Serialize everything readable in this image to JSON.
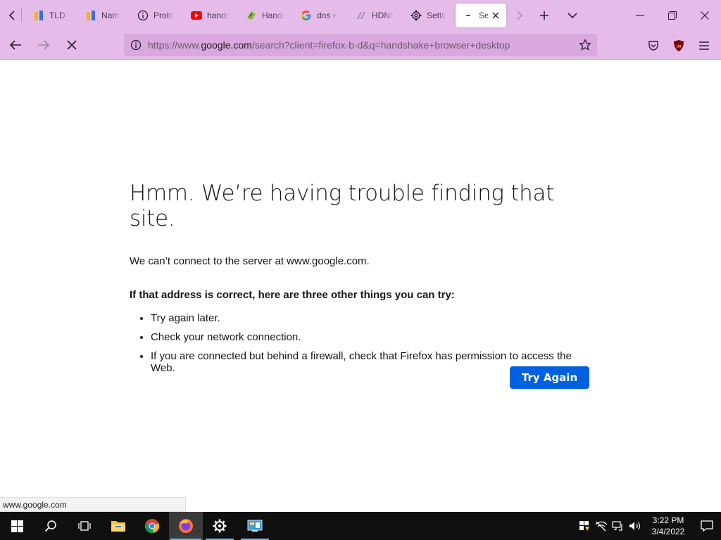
{
  "tabs": [
    {
      "title": "TLD R",
      "icon": "hns-icon"
    },
    {
      "title": "Name",
      "icon": "hns-icon"
    },
    {
      "title": "Proble",
      "icon": "info-icon"
    },
    {
      "title": "hands",
      "icon": "youtube-icon"
    },
    {
      "title": "Hands",
      "icon": "handshake-icon"
    },
    {
      "title": "dns e",
      "icon": "google-icon"
    },
    {
      "title": "HDNS",
      "icon": "hdns-icon"
    },
    {
      "title": "Settin",
      "icon": "gear-icon"
    },
    {
      "title": "Ser",
      "icon": "loading-icon",
      "active": true
    }
  ],
  "urlbar": {
    "prefix": "https://www.",
    "host": "google.com",
    "suffix": "/search?client=firefox-b-d&q=handshake+browser+desktop"
  },
  "error": {
    "title": "Hmm. We’re having trouble finding that site.",
    "message": "We can’t connect to the server at www.google.com.",
    "suggestions_heading": "If that address is correct, here are three other things you can try:",
    "suggestions": [
      "Try again later.",
      "Check your network connection.",
      "If you are connected but behind a firewall, check that Firefox has permission to access the Web."
    ],
    "button": "Try Again"
  },
  "statusbar": "www.google.com",
  "taskbar": {
    "time": "3:22 PM",
    "date": "3/4/2022"
  },
  "colors": {
    "toolbar": "#e4bbe9",
    "urlbar": "#d9a8df",
    "primary_button": "#0061e0",
    "taskbar": "#101010"
  }
}
